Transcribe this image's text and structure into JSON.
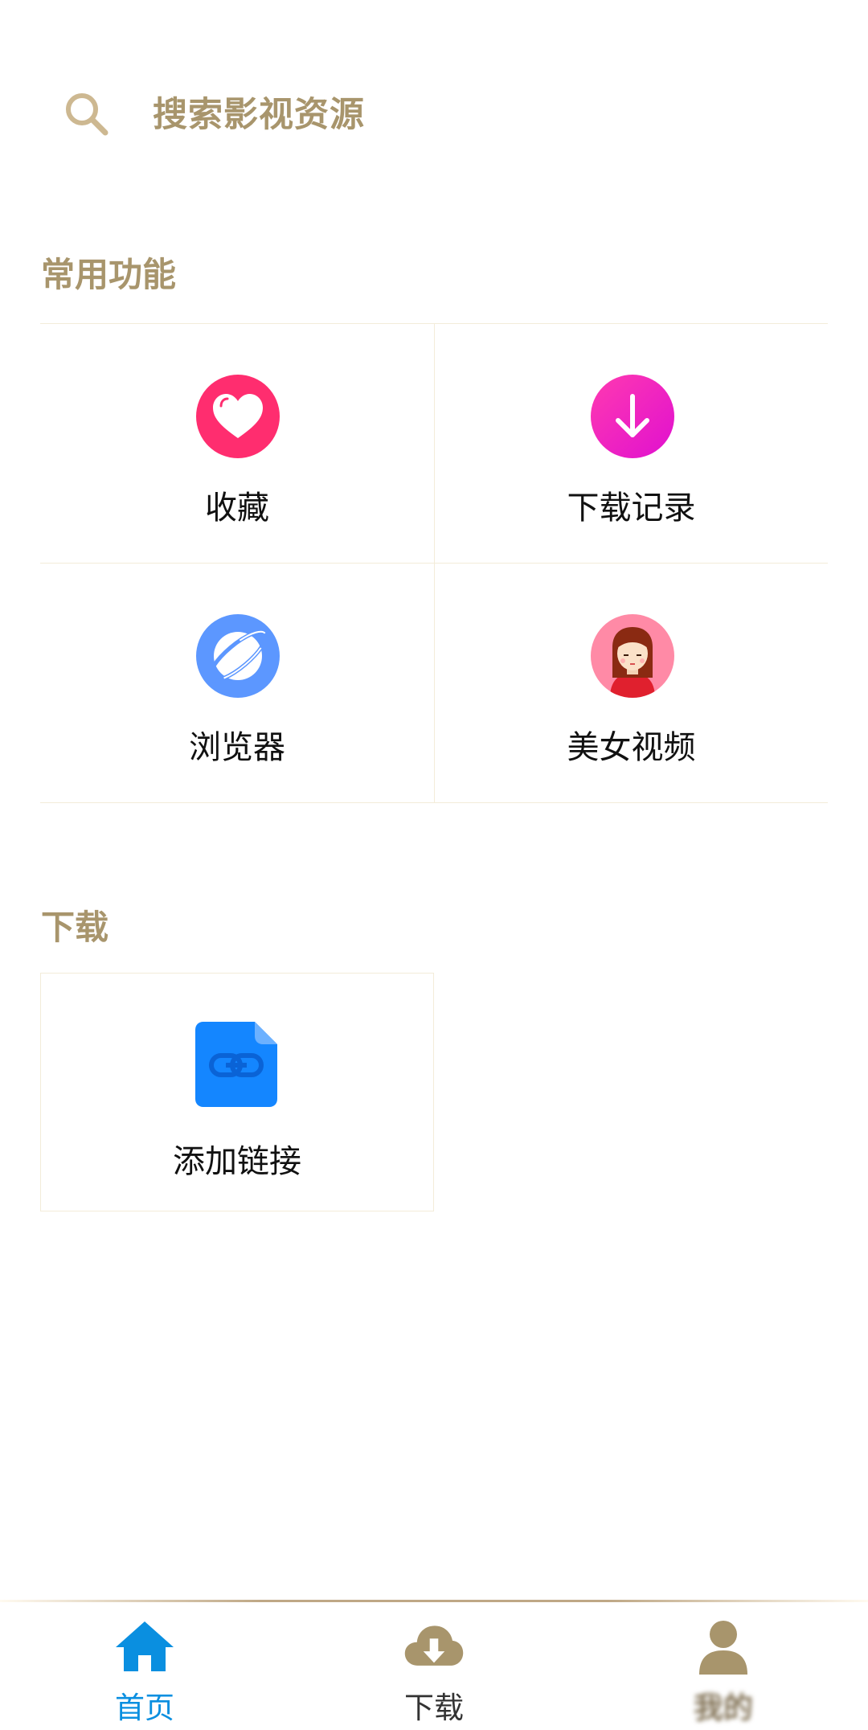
{
  "search": {
    "placeholder": "搜索影视资源"
  },
  "sections": {
    "common": {
      "title": "常用功能",
      "items": [
        {
          "label": "收藏",
          "icon": "heart-icon"
        },
        {
          "label": "下载记录",
          "icon": "download-arrow-icon"
        },
        {
          "label": "浏览器",
          "icon": "browser-planet-icon"
        },
        {
          "label": "美女视频",
          "icon": "girl-avatar-icon"
        }
      ]
    },
    "download": {
      "title": "下载",
      "items": [
        {
          "label": "添加链接",
          "icon": "link-file-icon"
        }
      ]
    }
  },
  "nav": {
    "home": "首页",
    "download": "下载",
    "me": "我的"
  },
  "colors": {
    "accent_gold": "#a8956c",
    "nav_active": "#0a8fe0",
    "heart_pink": "#ff2d6f",
    "download_magenta": "#f01cc4",
    "browser_blue": "#5c97ff",
    "link_blue": "#1486ff"
  }
}
